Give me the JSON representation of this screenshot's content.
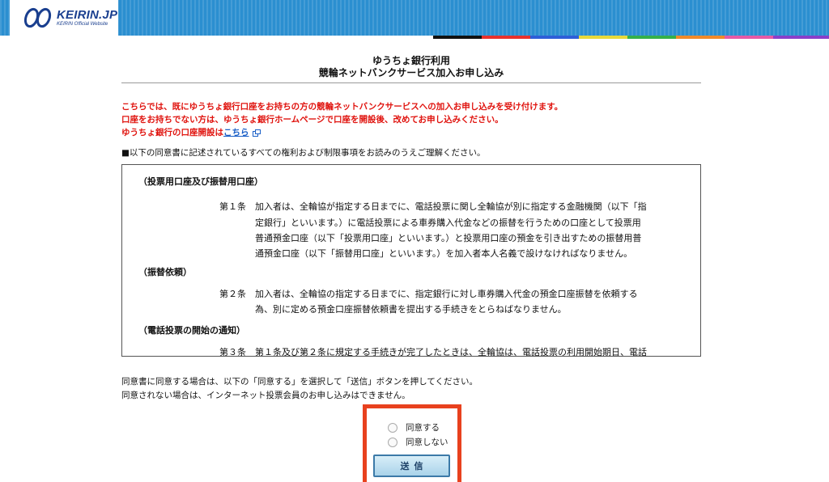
{
  "header": {
    "logo_text": "KEIRIN.JP",
    "logo_subtext": "KEIRIN Official Website",
    "strip_colors": [
      "#ffffff",
      "#111111",
      "#e8322d",
      "#2f5fd8",
      "#e8d93a",
      "#35b04a",
      "#f08a2a",
      "#e65aa6",
      "#8a3fc9"
    ],
    "brand_color": "#2b8fd0"
  },
  "title": {
    "line1": "ゆうちょ銀行利用",
    "line2": "競輪ネットバンクサービス加入お申し込み"
  },
  "notice": {
    "line1": "こちらでは、既にゆうちょ銀行口座をお持ちの方の競輪ネットバンクサービスへの加入お申し込みを受け付けます。",
    "line2": "口座をお持ちでない方は、ゆうちょ銀行ホームページで口座を開設後、改めてお申し込みください。",
    "line3_prefix": "ゆうちょ銀行の口座開設は",
    "line3_link": "こちら",
    "color": "#e0140f"
  },
  "intro": "■以下の同意書に記述されているすべての権利および制限事項をお読みのうえご理解ください。",
  "terms": {
    "heading1": "（投票用口座及び振替用口座）",
    "article1_label": "第１条",
    "article1_lines": [
      "加入者は、全輪協が指定する日までに、電話投票に関し全輪協が別に指定する金融機関（以下「指",
      "定銀行」といいます。）に電話投票による車券購入代金などの振替を行うための口座として投票用",
      "普通預金口座（以下「投票用口座」といいます。）と投票用口座の預金を引き出すための振替用普",
      "通預金口座（以下「振替用口座」といいます。）を加入者本人名義で設けなければなりません。"
    ],
    "heading2": "（振替依頼）",
    "article2_label": "第２条",
    "article2_lines": [
      "加入者は、全輪協の指定する日までに、指定銀行に対し車券購入代金の預金口座振替を依頼する",
      "為、別に定める預金口座振替依頼書を提出する手続きをとらねばなりません。"
    ],
    "heading3": "（電話投票の開始の通知）",
    "article3_label": "第３条",
    "article3_line": "第１条及び第２条に規定する手続きが完了したときは、全輪協は、電話投票の利用開始期日、電話"
  },
  "agree": {
    "line1": "同意書に同意する場合は、以下の「同意する」を選択して「送信」ボタンを押してください。",
    "line2": "同意されない場合は、インターネット投票会員のお申し込みはできません。"
  },
  "form": {
    "agree_label": "同意する",
    "disagree_label": "同意しない",
    "submit_label": "送信",
    "highlight_color": "#e8411e"
  }
}
